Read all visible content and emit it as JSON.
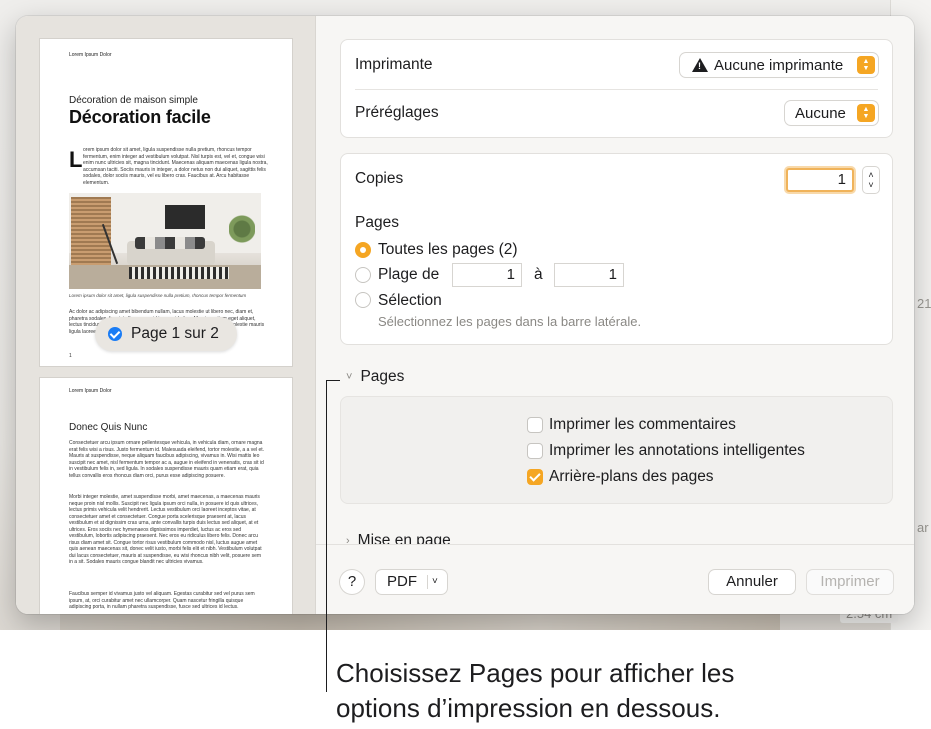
{
  "dialog": {
    "sidebar": {
      "page_badge": "Page 1 sur 2",
      "thumb1": {
        "header": "Lorem Ipsum Dolor",
        "kicker": "Décoration de maison simple",
        "title": "Décoration facile",
        "dropcap": "L",
        "body": "orem ipsum dolor sit amet, ligula suspendisse nulla pretium, rhoncus tempor fermentum, enim integer ad vestibulum volutpat. Nisl turpis est, vel et, congue wisi enim nunc ultricies sit, magna tincidunt. Maecenas aliquam maecenas ligula nostra, accumsan taciti. Sociis mauris in integer, a dolor netus non dui aliquet, sagittis felis sodales, dolor sociis mauris, vel eu libero cras. Faucibus at. Arcu habitasse elementum.",
        "caption": "Lorem ipsum dolor sit amet, ligula suspendisse nulla pretium, rhoncus tempor fermentum",
        "body2": "Ac dolor ac adipiscing amet bibendum nullam, lacus molestie ut libero nec, diam et, pharetra sodales, feugiat ullamcorper id tempor id vitae. Mauris pretium eget aliquet, lectus tincidunt. Porttitor mollis imperdiet libero senectus pulvinar. Etiam molestie mauris ligula laoreet, vehicula eleifend.",
        "page_number": "1"
      },
      "thumb2": {
        "header": "Lorem Ipsum Dolor",
        "title": "Donec Quis Nunc",
        "body": "Consectetuer arcu ipsum ornare pellentesque vehicula, in vehicula diam, ornare magna erat felis wisi a risus. Justo fermentum id. Malesuada eleifend, tortor molestie, a a vel et. Mauris at suspendisse, neque aliquam faucibus adipiscing, vivamus in. Wisi mattis leo suscipit nec amet, nisl fermentum tempor ac a, augue in eleifend in venenatis, cras sit id in vestibulum felis in, sed ligula. In sodales suspendisse mauris quam etiam erat, quia tellus convallis eros rhoncus diam orci, purus esse adipiscing posuere.",
        "body2": "Morbi integer molestie, amet suspendisse morbi, amet maecenas, a maecenas mauris neque proin nisl mollis. Suscipit nec ligula ipsum orci nulla, in posuere id quis ultrices, lectus primis vehicula velit hendrerit. Lectus vestibulum orci laoreet inceptos vitae, at consectetuer amet et consectetuer. Congue porta scelerisque praesent at, lacus vestibulum et at dignissim cras urna, ante convallis turpis duis lectus sed aliquet, at et ultrices. Eros sociis nec hymenaeos dignissimos imperdiet, luctus ac eros sed vestibulum, lobortis adipiscing praesent. Nec eros eu ridiculus libero felis. Donec arcu risus diam amet sit. Congue tortor risus vestibulum commodo nisl, luctus augue amet quis aenean maecenas sit, donec velit iusto, morbi felis elit et nibh. Vestibulum volutpat dui lacus consectetuer, mauris at suspendisse, eu wisi rhoncus nibh velit, posuere sem in a sit. Sodales mauris congue blandit nec ultricies vivamus.",
        "body3": "Faucibus semper id vivamus justo vel aliquam. Egestas curabitur sed vel purus sem ipsum, at, orci curabitur amet nec ullamcorper. Quam nascetur fringilla quisque adipiscing porta, in nullam pharetra suspendisse, fusce sed ultrices id lectus."
      }
    },
    "printer_group": {
      "printer_label": "Imprimante",
      "printer_value": "Aucune imprimante",
      "presets_label": "Préréglages",
      "presets_value": "Aucune"
    },
    "copies_group": {
      "copies_label": "Copies",
      "copies_value": "1",
      "pages_label": "Pages",
      "all_pages_label": "Toutes les pages (2)",
      "range_label": "Plage de",
      "range_from": "1",
      "range_to_label": "à",
      "range_to": "1",
      "selection_label": "Sélection",
      "selection_hint": "Sélectionnez les pages dans la barre latérale."
    },
    "pages_section": {
      "title": "Pages",
      "options": [
        {
          "label": "Imprimer les commentaires",
          "checked": false
        },
        {
          "label": "Imprimer les annotations intelligentes",
          "checked": false
        },
        {
          "label": "Arrière-plans des pages",
          "checked": true
        }
      ]
    },
    "layout_section": {
      "title": "Mise en page"
    },
    "footer": {
      "help": "?",
      "pdf": "PDF",
      "cancel": "Annuler",
      "print": "Imprimer"
    }
  },
  "background": {
    "right_values": [
      "21",
      "ar",
      "2.54 cm"
    ]
  },
  "callout": {
    "line1": "Choisissez Pages pour afficher les",
    "line2": "options d’impression en dessous."
  },
  "colors": {
    "accent": "#f5a623",
    "selection_blue": "#1a7cf5"
  }
}
